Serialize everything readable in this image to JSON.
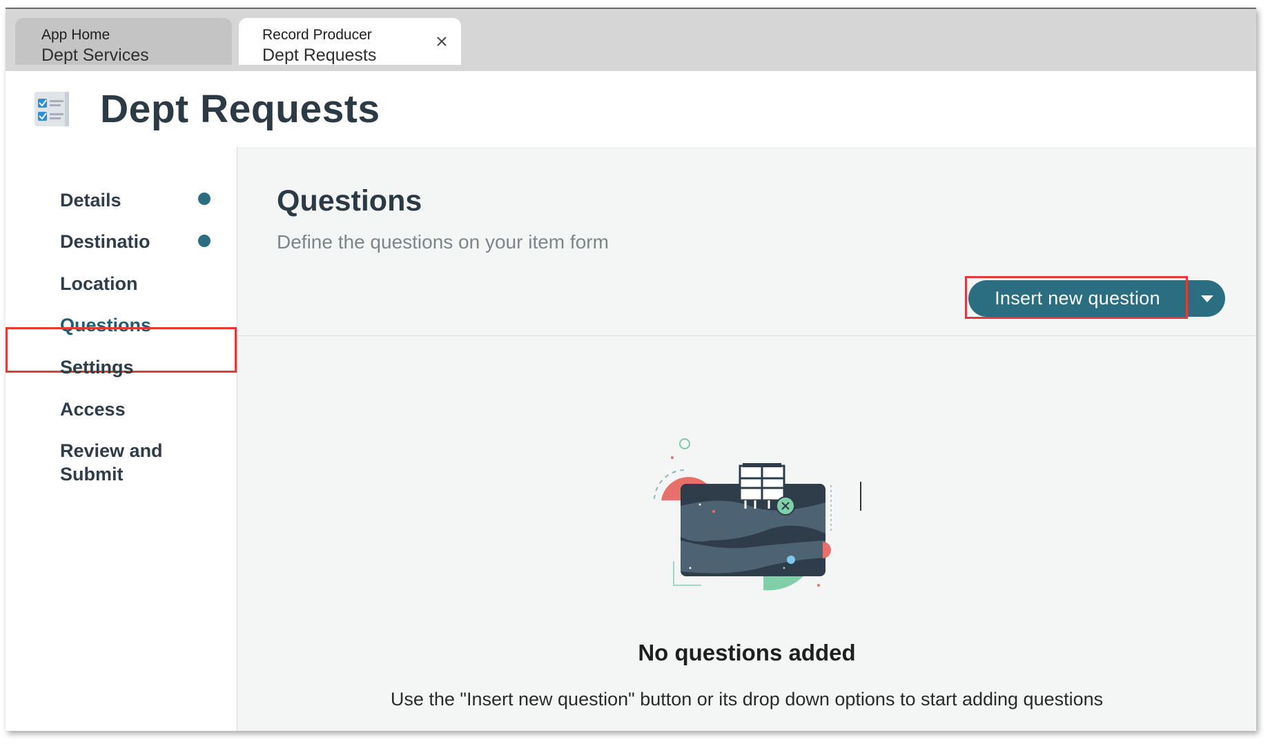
{
  "tabs": [
    {
      "line1": "App Home",
      "line2": "Dept Services",
      "active": false
    },
    {
      "line1": "Record Producer",
      "line2": "Dept Requests",
      "active": true,
      "close_icon": "close-icon"
    }
  ],
  "header": {
    "title": "Dept Requests",
    "icon": "checklist-icon"
  },
  "sidebar": {
    "items": [
      {
        "label": "Details",
        "status_dot": true
      },
      {
        "label": "Destinatio",
        "status_dot": true
      },
      {
        "label": "Location",
        "status_dot": false
      },
      {
        "label": "Questions",
        "status_dot": false,
        "selected": true
      },
      {
        "label": "Settings",
        "status_dot": false
      },
      {
        "label": "Access",
        "status_dot": false
      },
      {
        "label": "Review and Submit",
        "status_dot": false
      }
    ]
  },
  "main": {
    "title": "Questions",
    "subtitle": "Define the questions on your item form",
    "insert_button": "Insert new question",
    "dropdown_icon": "caret-down-icon",
    "empty_state": {
      "illustration": "empty-canvas-illustration",
      "title": "No questions added",
      "description": "Use the \"Insert new question\" button or its drop down options to start adding questions"
    }
  },
  "colors": {
    "accent": "#2b6e82",
    "highlight": "#e53935",
    "tabbar": "#d6d6d6",
    "panel": "#f4f5f5"
  }
}
